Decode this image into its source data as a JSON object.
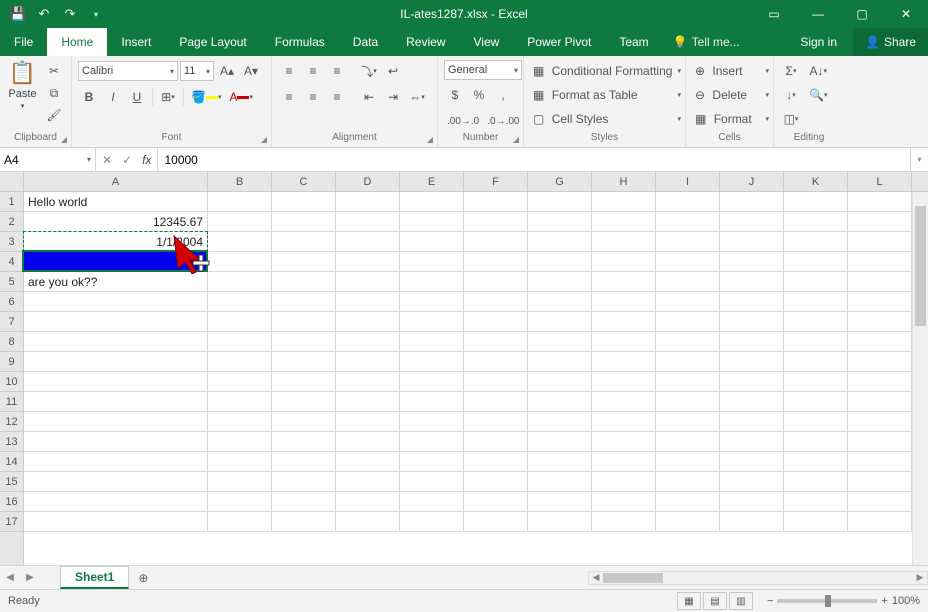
{
  "titlebar": {
    "filename": "IL-ates1287.xlsx - Excel"
  },
  "menubar": {
    "tabs": [
      "File",
      "Home",
      "Insert",
      "Page Layout",
      "Formulas",
      "Data",
      "Review",
      "View",
      "Power Pivot",
      "Team"
    ],
    "active_index": 1,
    "tellme": "Tell me...",
    "signin": "Sign in",
    "share": "Share"
  },
  "ribbon": {
    "clipboard": {
      "label": "Clipboard",
      "paste": "Paste"
    },
    "font": {
      "label": "Font",
      "name": "Calibri",
      "size": "11",
      "bold": "B",
      "italic": "I",
      "underline": "U"
    },
    "alignment": {
      "label": "Alignment"
    },
    "number": {
      "label": "Number",
      "format": "General",
      "currency": "$",
      "percent": "%",
      "comma": ","
    },
    "styles": {
      "label": "Styles",
      "conditional": "Conditional Formatting",
      "table": "Format as Table",
      "cellstyles": "Cell Styles"
    },
    "cells": {
      "label": "Cells",
      "insert": "Insert",
      "delete": "Delete",
      "format": "Format"
    },
    "editing": {
      "label": "Editing"
    }
  },
  "formulabar": {
    "namebox": "A4",
    "fx": "fx",
    "value": "10000"
  },
  "grid": {
    "columns": [
      "A",
      "B",
      "C",
      "D",
      "E",
      "F",
      "G",
      "H",
      "I",
      "J",
      "K",
      "L"
    ],
    "rows": [
      1,
      2,
      3,
      4,
      5,
      6,
      7,
      8,
      9,
      10,
      11,
      12,
      13,
      14,
      15,
      16,
      17
    ],
    "data": {
      "A1": "Hello world",
      "A2": "12345.67",
      "A3": "1/1/2004",
      "A5": "are you ok??"
    },
    "active_cell": "A4"
  },
  "sheettabs": {
    "active": "Sheet1"
  },
  "statusbar": {
    "mode": "Ready",
    "zoom": "100%"
  }
}
